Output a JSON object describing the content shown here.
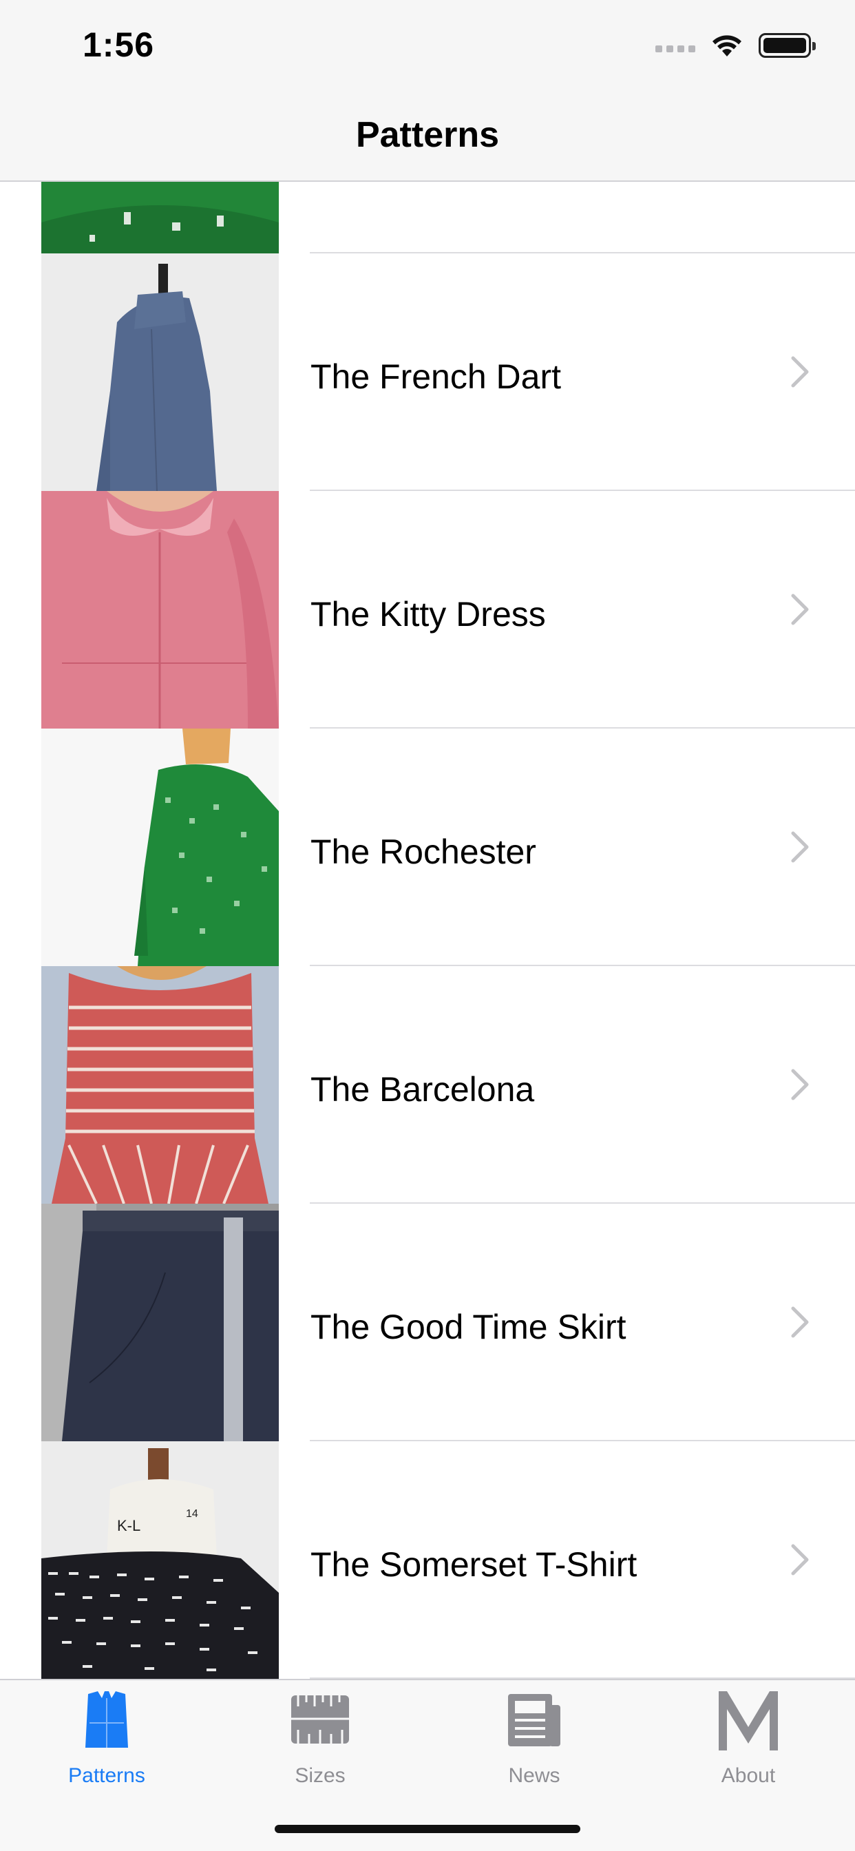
{
  "status_bar": {
    "time": "1:56"
  },
  "header": {
    "title": "Patterns"
  },
  "patterns": [
    {
      "label": ""
    },
    {
      "label": "The French Dart"
    },
    {
      "label": "The Kitty Dress"
    },
    {
      "label": "The Rochester"
    },
    {
      "label": "The Barcelona"
    },
    {
      "label": "The Good Time Skirt"
    },
    {
      "label": "The Somerset T-Shirt"
    }
  ],
  "tabs": [
    {
      "label": "Patterns",
      "icon": "vest-icon",
      "active": true
    },
    {
      "label": "Sizes",
      "icon": "tape-measure-icon",
      "active": false
    },
    {
      "label": "News",
      "icon": "newspaper-icon",
      "active": false
    },
    {
      "label": "About",
      "icon": "m-logo-icon",
      "active": false
    }
  ],
  "colors": {
    "accent": "#1a7cf5",
    "inactive": "#8e8e93",
    "separator": "#dcdce0"
  }
}
